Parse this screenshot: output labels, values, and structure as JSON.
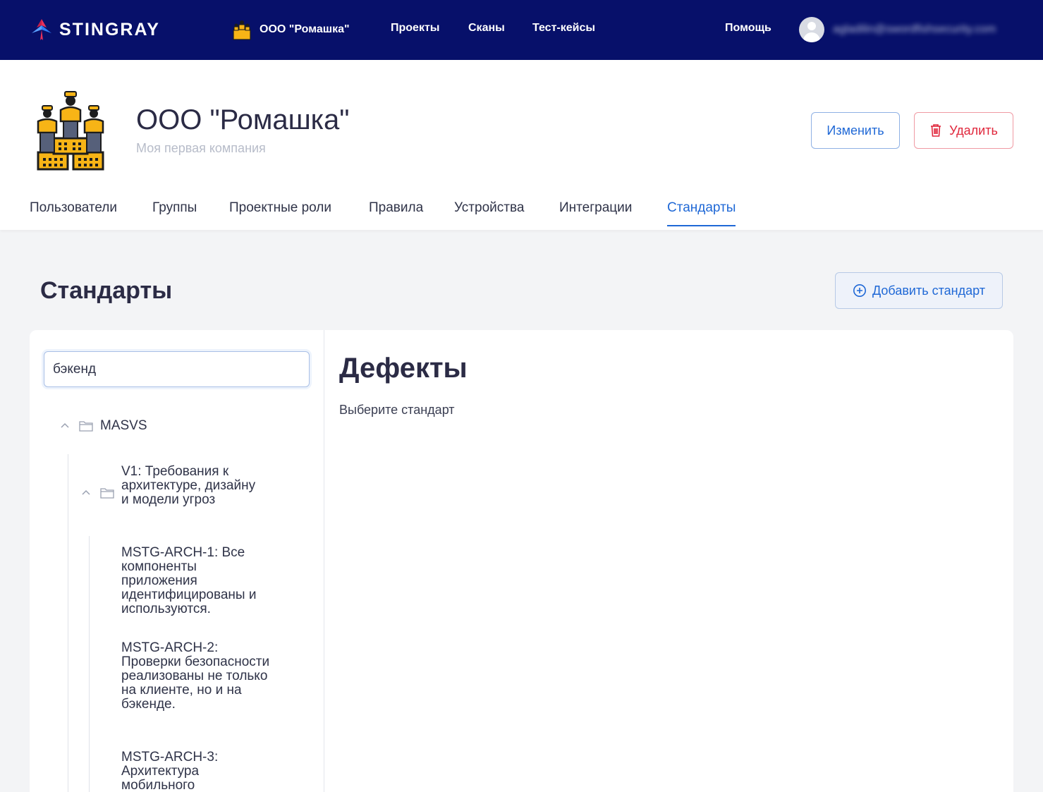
{
  "brand": {
    "name": "STINGRAY"
  },
  "topbar": {
    "org_name": "ООО \"Ромашка\"",
    "nav": [
      "Проекты",
      "Сканы",
      "Тест-кейсы"
    ],
    "help": "Помощь",
    "user_email": "agladilin@swordfishsecurity.com"
  },
  "company": {
    "title": "ООО \"Ромашка\"",
    "subtitle": "Моя первая компания",
    "edit_label": "Изменить",
    "delete_label": "Удалить"
  },
  "tabs": [
    {
      "label": "Пользователи",
      "active": false
    },
    {
      "label": "Группы",
      "active": false
    },
    {
      "label": "Проектные роли",
      "active": false
    },
    {
      "label": "Правила",
      "active": false
    },
    {
      "label": "Устройства",
      "active": false
    },
    {
      "label": "Интеграции",
      "active": false
    },
    {
      "label": "Стандарты",
      "active": true
    }
  ],
  "page": {
    "title": "Стандарты",
    "add_label": "Добавить стандарт"
  },
  "search": {
    "value": "бэкенд"
  },
  "tree": {
    "root": "MASVS",
    "group": "V1: Требования к архитектуре, дизайну и модели угроз",
    "items": [
      "MSTG-ARCH-1: Все компоненты приложения идентифицированы и используются.",
      "MSTG-ARCH-2: Проверки безопасности реализованы не только на клиенте, но и на бэкенде.",
      "MSTG-ARCH-3: Архитектура мобильного"
    ]
  },
  "defects": {
    "title": "Дефекты",
    "hint": "Выберите стандарт"
  },
  "colors": {
    "topbar": "#07106a",
    "accent": "#1f68d6",
    "danger": "#e0263b",
    "logo_orange": "#f7b416"
  }
}
